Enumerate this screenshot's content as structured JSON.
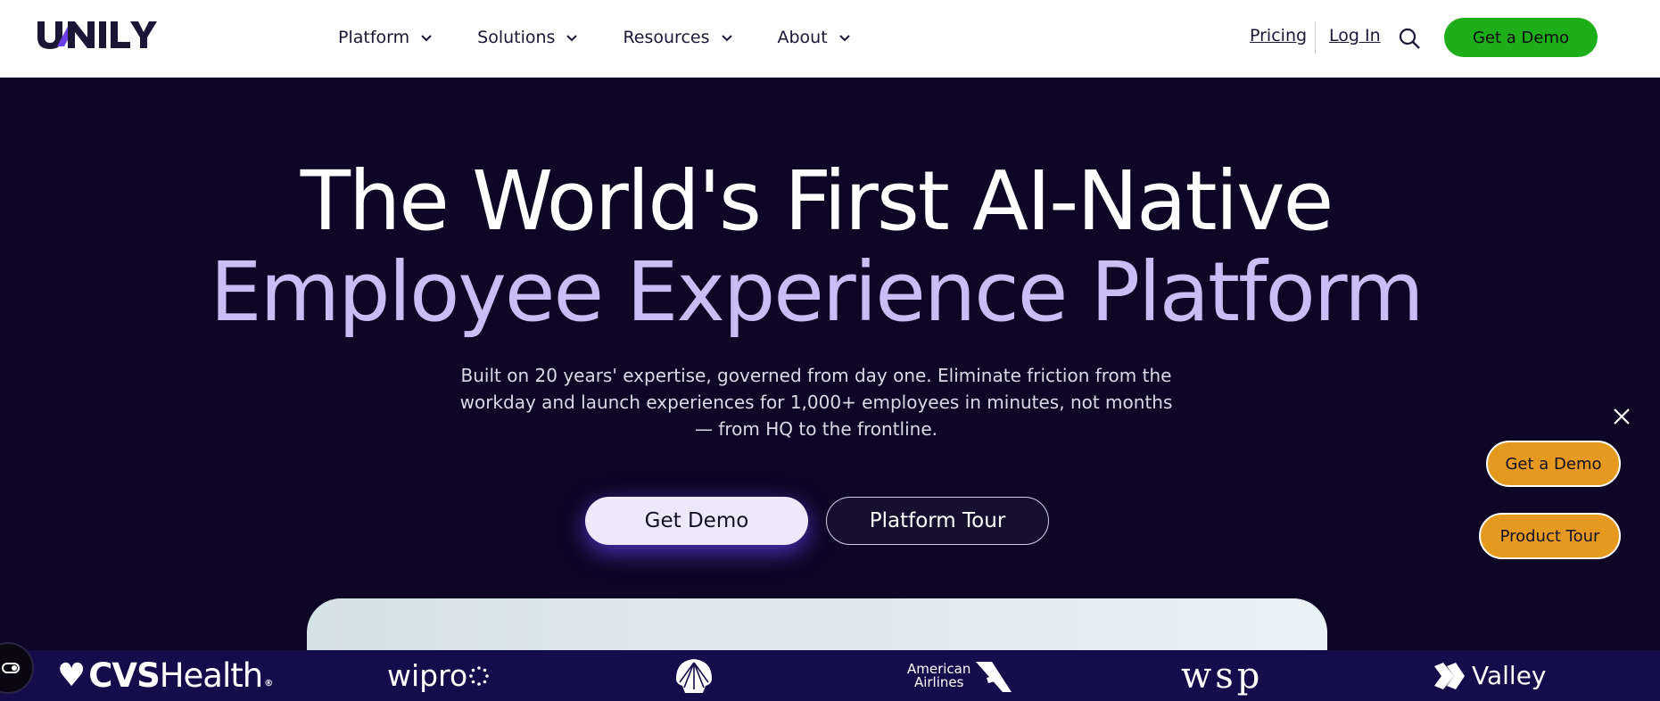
{
  "header": {
    "nav": [
      {
        "label": "Platform"
      },
      {
        "label": "Solutions"
      },
      {
        "label": "Resources"
      },
      {
        "label": "About"
      }
    ],
    "pricing": "Pricing",
    "login": "Log In",
    "demo": "Get a Demo"
  },
  "hero": {
    "line1": "The World's First AI-Native",
    "line2": "Employee Experience Platform",
    "subtitle": "Built on 20 years' expertise, governed from day one. Eliminate friction from the workday and launch experiences for 1,000+ employees in minutes, not months — from HQ to the frontline.",
    "cta_primary": "Get Demo",
    "cta_secondary": "Platform Tour"
  },
  "floating": {
    "demo": "Get a Demo",
    "tour": "Product Tour"
  },
  "logos": {
    "cvs_bold": "CVS",
    "cvs_light": "Health",
    "wipro": "wipro",
    "american_line1": "American",
    "american_line2": "Airlines",
    "wsp": "wsp",
    "valley": "Valley"
  },
  "colors": {
    "hero_bg": "#0d0625",
    "accent_lavender": "#cabdf5",
    "demo_green": "#1eae1a",
    "float_orange": "#e59a1f",
    "logo_strip": "#140c4b"
  }
}
